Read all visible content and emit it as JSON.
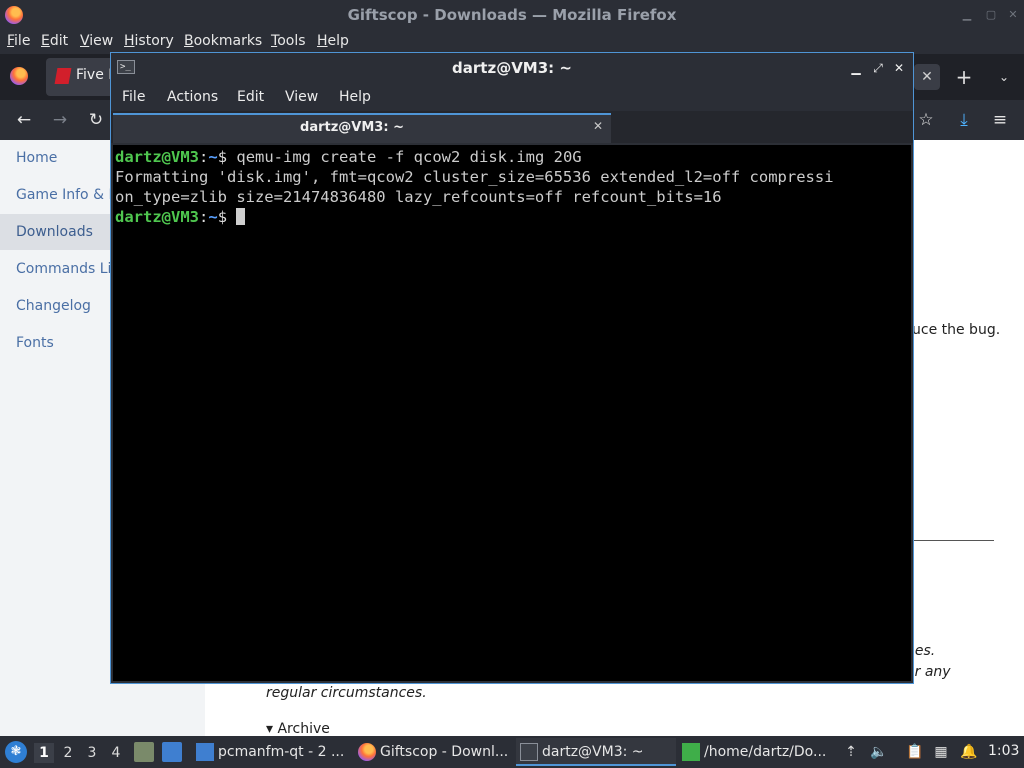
{
  "firefox": {
    "window_title": "Giftscop - Downloads — Mozilla Firefox",
    "menu": [
      "File",
      "Edit",
      "View",
      "History",
      "Bookmarks",
      "Tools",
      "Help"
    ],
    "tab_label": "Five I",
    "tab_close": "✕",
    "new_tab": "+",
    "tab_list": "⌄",
    "nav": {
      "back": "←",
      "forward": "→",
      "reload": "↻",
      "bookmark_star": "☆",
      "downloads": "⤓",
      "menu": "≡"
    }
  },
  "page": {
    "sidebar": [
      {
        "label": "Home",
        "active": false
      },
      {
        "label": "Game Info & H",
        "active": false
      },
      {
        "label": "Downloads",
        "active": true
      },
      {
        "label": "Commands Lis",
        "active": false
      },
      {
        "label": "Changelog",
        "active": false
      },
      {
        "label": "Fonts",
        "active": false
      }
    ],
    "text_bug": "uce the bug.",
    "text_nes": "nes.",
    "text_any": "er any",
    "text_regular": "regular circumstances.",
    "archive": "▾ Archive"
  },
  "terminal": {
    "window_title": "dartz@VM3: ~",
    "menu": [
      "File",
      "Actions",
      "Edit",
      "View",
      "Help"
    ],
    "tab_label": "dartz@VM3: ~",
    "prompt_user": "dartz@VM3",
    "prompt_path": "~",
    "command": "qemu-img create -f qcow2 disk.img 20G",
    "output": [
      "Formatting 'disk.img', fmt=qcow2 cluster_size=65536 extended_l2=off compressi",
      "on_type=zlib size=21474836480 lazy_refcounts=off refcount_bits=16"
    ]
  },
  "taskbar": {
    "workspaces": [
      "1",
      "2",
      "3",
      "4"
    ],
    "active_workspace": "1",
    "tasks": [
      {
        "label": "pcmanfm-qt - 2 ...",
        "icon": "folder-icon"
      },
      {
        "label": "Giftscop - Downl...",
        "icon": "firefox-icon"
      },
      {
        "label": "dartz@VM3: ~",
        "icon": "terminal-icon"
      },
      {
        "label": "/home/dartz/Do...",
        "icon": "archive-icon"
      }
    ],
    "clock": "1:03"
  },
  "colors": {
    "accent": "#4f95d6",
    "prompt_green": "#4fc74f",
    "prompt_blue": "#5aa0ff",
    "link": "#4a6fa5"
  }
}
